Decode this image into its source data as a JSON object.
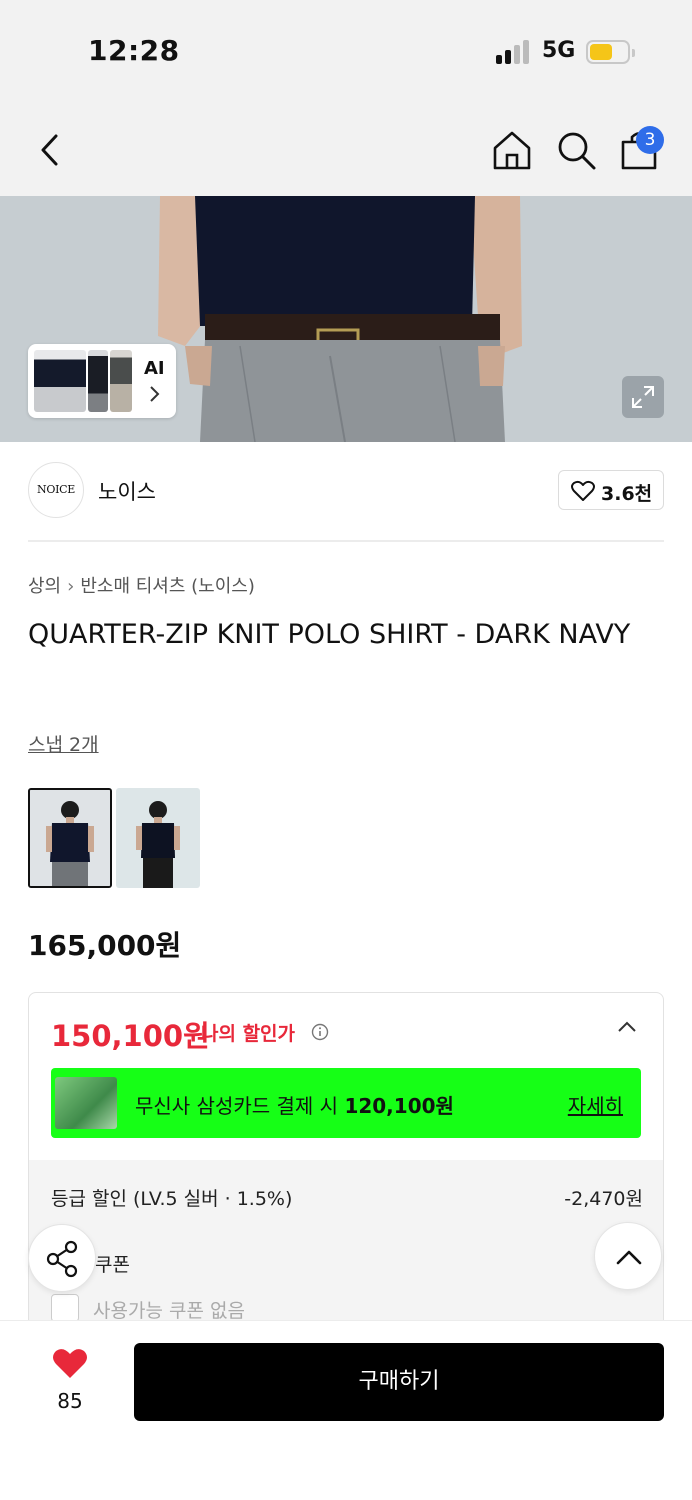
{
  "status_bar": {
    "time": "12:28",
    "network": "5G",
    "battery_level": 0.5,
    "battery_color": "#f5c518"
  },
  "nav": {
    "back_icon": "chevron-left-icon",
    "home_icon": "home-icon",
    "search_icon": "search-icon",
    "cart_icon": "shopping-bag-icon",
    "cart_badge": "3"
  },
  "hero": {
    "ai_label": "AI",
    "expand_icon": "expand-icon"
  },
  "brand": {
    "logo_text": "NOICE",
    "name": "노이스",
    "likes": "3.6천"
  },
  "breadcrumb": {
    "category": "상의",
    "subcategory": "반소매 티셔츠 (노이스)"
  },
  "product": {
    "title": "QUARTER-ZIP KNIT POLO SHIRT - DARK NAVY",
    "snap_link": "스냅 2개",
    "original_price": "165,000원"
  },
  "pricing": {
    "my_price": "150,100원",
    "my_price_label": "나의 할인가",
    "card_offer_prefix": "무신사 삼성카드 결제 시 ",
    "card_offer_price": "120,100원",
    "card_offer_detail": "자세히",
    "tier_discount_label": "등급 할인 (LV.5 실버 · 1.5%)",
    "tier_discount_value": "-2,470원",
    "coupon_label": "쿠폰",
    "coupon_none": "사용가능 쿠폰 없음"
  },
  "bottom_bar": {
    "wishlist_count": "85",
    "buy_label": "구매하기"
  },
  "colors": {
    "accent_red": "#e8283a",
    "card_green": "#16ff16",
    "badge_blue": "#2f6de9",
    "buy_bg": "#000000"
  }
}
